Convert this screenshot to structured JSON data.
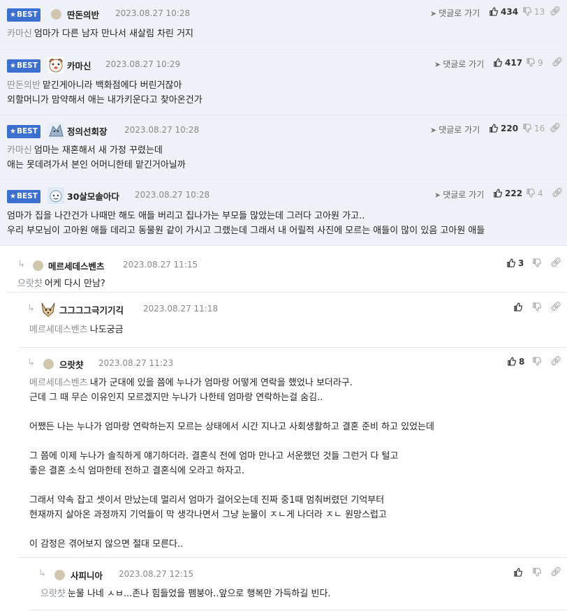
{
  "best_label": "BEST",
  "reply_link_label": "댓글로 가기",
  "best_comments": [
    {
      "nick": "딴돈의반",
      "date": "2023.08.27 10:28",
      "up": "434",
      "down": "13",
      "mention": "카마신",
      "lines": [
        "엄마가 다른 남자 만나서 새살림 차린 거지"
      ]
    },
    {
      "nick": "카마신",
      "date": "2023.08.27 10:29",
      "up": "417",
      "down": "9",
      "mention": "딴돈의반",
      "lines": [
        "맡긴게아니라 백화점에다 버린거잖아",
        "외할머니가 맘약해서 애는 내가키운다고 찾아온건가"
      ]
    },
    {
      "nick": "정의선회장",
      "date": "2023.08.27 10:28",
      "up": "220",
      "down": "16",
      "mention": "카마신",
      "lines": [
        "엄마는 재혼해서 새 가정 꾸렸는데",
        "애는 못데려가서 본인 어머니한테 맡긴거아닐까"
      ]
    },
    {
      "nick": "30살모솔아다",
      "date": "2023.08.27 10:28",
      "up": "222",
      "down": "4",
      "mention": "",
      "lines": [
        "엄마가 집을 나간건가 나때만 해도 애들 버리고 집나가는 부모들 많았는데 그러다 고아원 가고..",
        "우리 부모님이 고아원 애들 데리고 동물원 같이 가시고 그랬는데 그래서 내 어릴적 사진에 모르는 애들이 많이 있음 고아원 애들"
      ]
    }
  ],
  "replies": [
    {
      "nick": "메르세데스벤츠",
      "date": "2023.08.27 11:15",
      "up": "3",
      "mention": "으랏챳",
      "lines": [
        "어케 다시 만남?"
      ]
    },
    {
      "nick": "그그그그극기기긱",
      "date": "2023.08.27 11:18",
      "up": "",
      "mention": "메르세데스벤츠",
      "lines": [
        "나도궁금"
      ]
    },
    {
      "nick": "으랏챳",
      "date": "2023.08.27 11:23",
      "up": "8",
      "mention": "메르세데스벤츠",
      "lines": [
        "내가 군대에 있을 쯤에 누나가 엄마랑 어떻게 연락을 했었나 보더라구.",
        "근데 그 때 무슨 이유인지 모르겠지만 누나가 나한테 엄마랑 연락하는걸 숨김..",
        "",
        "어쨌든 나는 누나가 엄마랑 연락하는지 모르는 상태에서 시간 지나고 사회생활하고 결혼 준비 하고 있었는데",
        "",
        "그 쯤에 이제 누나가 솔직하게 얘기하더라. 결혼식 전에 엄마 만나고 서운했던 것들 그런거 다 털고",
        "좋은 결혼 소식 엄마한테 전하고 결혼식에 오라고 하자고.",
        "",
        "그래서 약속 잡고 셋이서 만났는데 멀리서 엄마가 걸어오는데 진짜 중1때 멈춰버렸던 기억부터",
        "현재까지 살아온 과정까지 기억들이 막 생각나면서 그냥 눈물이 ㅈㄴ게 나더라 ㅈㄴ 원망스럽고",
        "",
        "이 감정은 겪어보지 않으면 절대 모른다.."
      ]
    },
    {
      "nick": "사피니아",
      "date": "2023.08.27 12:15",
      "up": "",
      "mention": "으랏챳",
      "lines": [
        "눈물 나네 ㅅㅂ...존나 힘들었을 펨붕아..앞으로 행복만 가득하길 빈다."
      ]
    }
  ]
}
